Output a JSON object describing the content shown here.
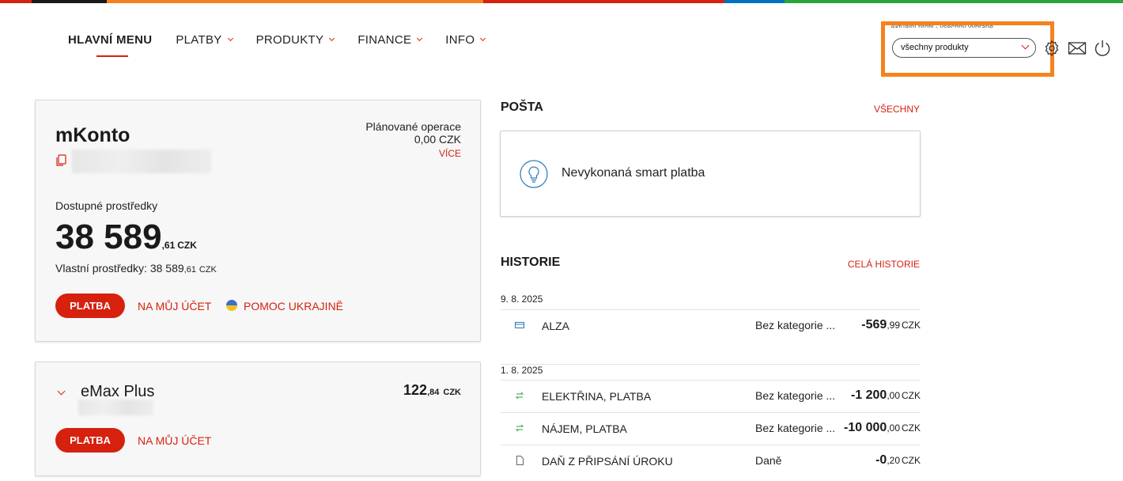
{
  "stripe_colors": [
    "#d6210f",
    "#1a1a1a",
    "#f5821f",
    "#d6210f",
    "#0073c0",
    "#27a639"
  ],
  "nav": {
    "main_menu": "HLAVNÍ MENU",
    "items": [
      "PLATBY",
      "PRODUKTY",
      "FINANCE",
      "INFO"
    ]
  },
  "profile": {
    "label": "Aktuální profil - všechny vybrané",
    "selected": "všechny produkty"
  },
  "accent_color": "#d6210f",
  "highlight_color": "#f5821f",
  "account": {
    "name": "mKonto",
    "planned_label": "Plánované operace",
    "planned_value": "0,00 CZK",
    "more": "VÍCE",
    "available_label": "Dostupné prostředky",
    "available_int": "38 589",
    "available_dec": ",61",
    "currency": "CZK",
    "own_label": "Vlastní prostředky: 38 589",
    "own_dec": ",61",
    "pay": "PLATBA",
    "to_my_account": "NA MŮJ ÚČET",
    "help_ukraine": "POMOC UKRAJINĚ"
  },
  "emax": {
    "name": "eMax Plus",
    "amount_int": "122",
    "amount_dec": ",84",
    "currency": "CZK",
    "pay": "PLATBA",
    "to_my_account": "NA MŮJ ÚČET"
  },
  "mail": {
    "title": "POŠTA",
    "all": "VŠECHNY",
    "message": "Nevykonaná smart platba"
  },
  "history": {
    "title": "HISTORIE",
    "all": "CELÁ HISTORIE",
    "groups": [
      {
        "date": "9. 8. 2025",
        "rows": [
          {
            "icon": "card-icon",
            "title": "ALZA",
            "category": "Bez kategorie ...",
            "amount_int": "-569",
            "amount_dec": ",99",
            "currency": "CZK"
          }
        ]
      },
      {
        "date": "1. 8. 2025",
        "rows": [
          {
            "icon": "transfer-icon",
            "title": "ELEKTŘINA, PLATBA",
            "category": "Bez kategorie ...",
            "amount_int": "-1 200",
            "amount_dec": ",00",
            "currency": "CZK"
          },
          {
            "icon": "transfer-icon",
            "title": "NÁJEM, PLATBA",
            "category": "Bez kategorie ...",
            "amount_int": "-10 000",
            "amount_dec": ",00",
            "currency": "CZK"
          },
          {
            "icon": "document-icon",
            "title": "DAŇ Z PŘIPSÁNÍ ÚROKU",
            "category": "Daně",
            "amount_int": "-0",
            "amount_dec": ",20",
            "currency": "CZK"
          }
        ]
      }
    ]
  }
}
